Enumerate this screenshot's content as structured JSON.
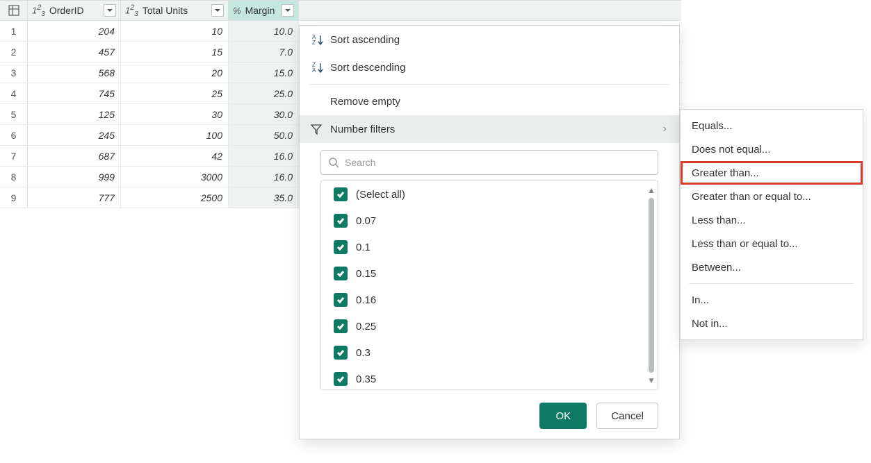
{
  "columns": [
    {
      "name": "OrderID",
      "type_icon": "num"
    },
    {
      "name": "Total Units",
      "type_icon": "num"
    },
    {
      "name": "Margin",
      "type_icon": "pct"
    }
  ],
  "rows": [
    {
      "n": "1",
      "order": "204",
      "units": "10",
      "margin": "10.0"
    },
    {
      "n": "2",
      "order": "457",
      "units": "15",
      "margin": "7.0"
    },
    {
      "n": "3",
      "order": "568",
      "units": "20",
      "margin": "15.0"
    },
    {
      "n": "4",
      "order": "745",
      "units": "25",
      "margin": "25.0"
    },
    {
      "n": "5",
      "order": "125",
      "units": "30",
      "margin": "30.0"
    },
    {
      "n": "6",
      "order": "245",
      "units": "100",
      "margin": "50.0"
    },
    {
      "n": "7",
      "order": "687",
      "units": "42",
      "margin": "16.0"
    },
    {
      "n": "8",
      "order": "999",
      "units": "3000",
      "margin": "16.0"
    },
    {
      "n": "9",
      "order": "777",
      "units": "2500",
      "margin": "35.0"
    }
  ],
  "menu": {
    "sort_asc": "Sort ascending",
    "sort_desc": "Sort descending",
    "remove_empty": "Remove empty",
    "number_filters": "Number filters"
  },
  "search": {
    "placeholder": "Search"
  },
  "filter_values": [
    "(Select all)",
    "0.07",
    "0.1",
    "0.15",
    "0.16",
    "0.25",
    "0.3",
    "0.35"
  ],
  "buttons": {
    "ok": "OK",
    "cancel": "Cancel"
  },
  "submenu": {
    "equals": "Equals...",
    "not_equal": "Does not equal...",
    "greater": "Greater than...",
    "greater_eq": "Greater than or equal to...",
    "less": "Less than...",
    "less_eq": "Less than or equal to...",
    "between": "Between...",
    "in": "In...",
    "not_in": "Not in..."
  },
  "colors": {
    "accent": "#0f7a63",
    "highlight_red": "#d83a2b",
    "selected_header": "#c4e8e0"
  }
}
